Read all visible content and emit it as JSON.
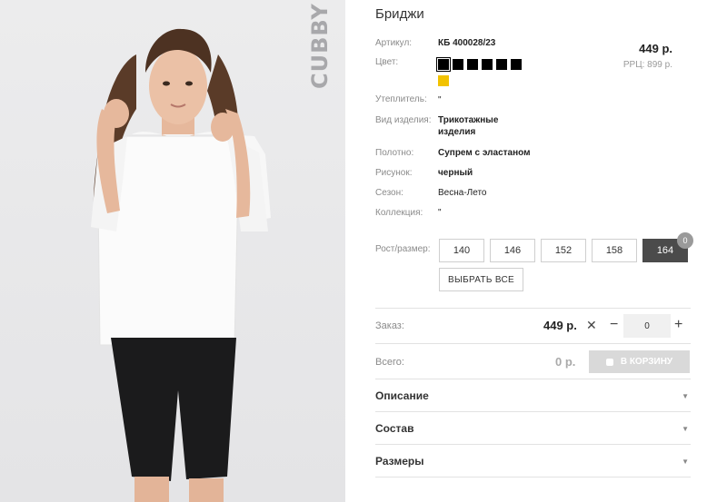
{
  "product": {
    "title": "Бриджи",
    "brand_watermark": "CUBBY",
    "price": "449 р.",
    "rrp": "РРЦ: 899 р."
  },
  "attributes": {
    "article_label": "Артикул:",
    "article_value": "КБ 400028/23",
    "color_label": "Цвет:",
    "insulation_label": "Утеплитель:",
    "insulation_value": "\"",
    "type_label": "Вид изделия:",
    "type_value": "Трикотажные изделия",
    "fabric_label": "Полотно:",
    "fabric_value": "Супрем с эластаном",
    "pattern_label": "Рисунок:",
    "pattern_value": "черный",
    "season_label": "Сезон:",
    "season_value": "Весна-Лето",
    "collection_label": "Коллекция:",
    "collection_value": "\"",
    "size_label": "Рост/размер:"
  },
  "colors": [
    "#000000",
    "#000000",
    "#000000",
    "#000000",
    "#000000",
    "#000000",
    "#f2c200"
  ],
  "sizes": {
    "items": [
      "140",
      "146",
      "152",
      "158",
      "164"
    ],
    "active": "164",
    "badge": "0",
    "select_all": "ВЫБРАТЬ ВСЕ"
  },
  "order": {
    "label": "Заказ:",
    "price": "449 р.",
    "times": "✕",
    "minus": "−",
    "qty": "0",
    "plus": "+"
  },
  "total": {
    "label": "Всего:",
    "price": "0 р.",
    "cart_button": "В КОРЗИНУ"
  },
  "accordion": [
    {
      "title": "Описание",
      "arrow": "▼"
    },
    {
      "title": "Состав",
      "arrow": "▼"
    },
    {
      "title": "Размеры",
      "arrow": "▼"
    }
  ]
}
